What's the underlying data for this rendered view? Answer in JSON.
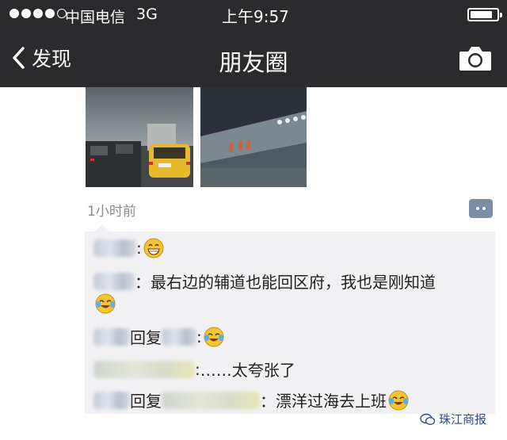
{
  "status_bar": {
    "carrier": "中国电信",
    "network": "3G",
    "time": "上午9:57",
    "battery_level": 0.85
  },
  "nav": {
    "back_label": "发现",
    "title": "朋友圈"
  },
  "post": {
    "timestamp": "1小时前"
  },
  "comments": [
    {
      "text": ""
    },
    {
      "text": "最右边的辅道也能回区府，我也是刚知道"
    },
    {
      "reply_word": "回复",
      "text": ""
    },
    {
      "text": "……太夸张了"
    },
    {
      "reply_word": "回复",
      "text": "漂洋过海去上班"
    }
  ],
  "watermark": "珠江商报",
  "icons": {
    "back": "chevron-left-icon",
    "camera": "camera-icon",
    "more": "more-dots-icon"
  },
  "colors": {
    "nav_background": "#2b2b2e",
    "comment_background": "#f1f1f3",
    "more_button": "#7c8da6"
  }
}
